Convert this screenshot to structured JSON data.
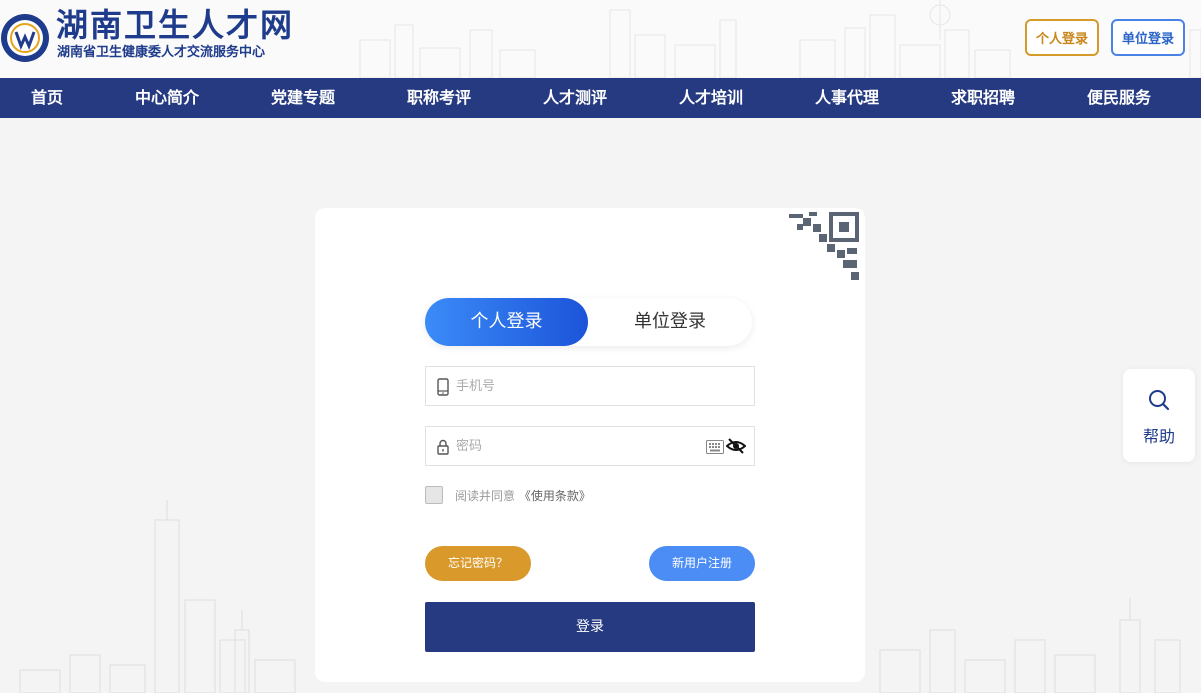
{
  "header": {
    "title": "湖南卫生人才网",
    "subtitle": "湖南省卫生健康委人才交流服务中心",
    "personal_login": "个人登录",
    "unit_login": "单位登录"
  },
  "nav": {
    "items": [
      "首页",
      "中心简介",
      "党建专题",
      "职称考评",
      "人才测评",
      "人才培训",
      "人事代理",
      "求职招聘",
      "便民服务"
    ]
  },
  "login": {
    "tabs": {
      "personal": "个人登录",
      "unit": "单位登录"
    },
    "phone_placeholder": "手机号",
    "password_placeholder": "密码",
    "agree_text": "阅读并同意",
    "terms_link": "《使用条款》",
    "forgot_password": "忘记密码？",
    "register": "新用户注册",
    "submit": "登录"
  },
  "help": {
    "label": "帮助"
  },
  "icons": {
    "phone": "phone-icon",
    "lock": "lock-icon",
    "keyboard": "keyboard-icon",
    "eye": "eye-slash-icon",
    "help": "search-icon",
    "qr": "qr-code-icon"
  },
  "colors": {
    "brand": "#253a80",
    "accent_gold": "#d99a2b",
    "accent_blue": "#4b8cf5"
  }
}
